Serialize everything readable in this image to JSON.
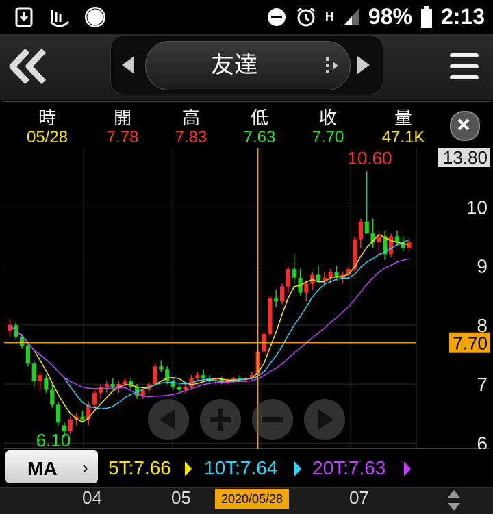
{
  "status": {
    "battery": "98%",
    "time": "2:13",
    "network": "H"
  },
  "header": {
    "stock_name": "友達"
  },
  "quote": {
    "labels": [
      "時",
      "開",
      "高",
      "低",
      "收",
      "量"
    ],
    "values": [
      "05/28",
      "7.78",
      "7.83",
      "7.63",
      "7.70",
      "47.1K"
    ],
    "colors": [
      "#ffe600",
      "#ff3030",
      "#ff3030",
      "#28e028",
      "#28e028",
      "#ffe600"
    ]
  },
  "chart_data": {
    "type": "candlestick",
    "high_marker": "10.60",
    "low_marker": "6.10",
    "price_ticks": [
      "13.80",
      "10",
      "9",
      "8",
      "7",
      "6"
    ],
    "cursor_price": "7.70",
    "x_ticks": [
      "04",
      "05",
      "07"
    ],
    "cursor_date": "2020/05/28",
    "ylim": [
      5.9,
      11.0
    ],
    "candles": [
      [
        7.9,
        8.1,
        7.8,
        8.0
      ],
      [
        8.0,
        8.05,
        7.75,
        7.8
      ],
      [
        7.8,
        7.85,
        7.6,
        7.65
      ],
      [
        7.65,
        7.7,
        7.3,
        7.35
      ],
      [
        7.35,
        7.4,
        6.95,
        7.05
      ],
      [
        7.05,
        7.2,
        6.9,
        7.15
      ],
      [
        7.1,
        7.15,
        6.85,
        6.9
      ],
      [
        6.9,
        7.0,
        6.6,
        6.65
      ],
      [
        6.65,
        6.7,
        6.3,
        6.35
      ],
      [
        6.3,
        6.35,
        6.1,
        6.2
      ],
      [
        6.2,
        6.45,
        6.15,
        6.4
      ],
      [
        6.4,
        6.5,
        6.3,
        6.45
      ],
      [
        6.45,
        6.55,
        6.35,
        6.4
      ],
      [
        6.4,
        6.7,
        6.3,
        6.65
      ],
      [
        6.65,
        6.9,
        6.6,
        6.85
      ],
      [
        6.85,
        7.0,
        6.75,
        6.95
      ],
      [
        6.95,
        7.05,
        6.85,
        7.0
      ],
      [
        7.0,
        7.1,
        6.9,
        6.95
      ],
      [
        6.95,
        7.05,
        6.85,
        7.0
      ],
      [
        7.0,
        7.1,
        6.95,
        7.05
      ],
      [
        7.05,
        7.1,
        6.9,
        6.95
      ],
      [
        6.95,
        7.0,
        6.75,
        6.8
      ],
      [
        6.8,
        6.95,
        6.75,
        6.9
      ],
      [
        6.9,
        7.05,
        6.85,
        7.0
      ],
      [
        7.0,
        7.35,
        6.95,
        7.3
      ],
      [
        7.3,
        7.4,
        7.2,
        7.25
      ],
      [
        7.25,
        7.3,
        7.0,
        7.05
      ],
      [
        7.05,
        7.1,
        6.9,
        6.95
      ],
      [
        6.95,
        7.0,
        6.85,
        6.9
      ],
      [
        6.9,
        7.0,
        6.85,
        6.95
      ],
      [
        6.95,
        7.15,
        6.9,
        7.1
      ],
      [
        7.1,
        7.2,
        7.05,
        7.15
      ],
      [
        7.15,
        7.25,
        7.05,
        7.1
      ],
      [
        7.1,
        7.15,
        7.0,
        7.05
      ],
      [
        7.05,
        7.1,
        7.0,
        7.08
      ],
      [
        7.08,
        7.12,
        7.0,
        7.04
      ],
      [
        7.04,
        7.1,
        7.0,
        7.07
      ],
      [
        7.07,
        7.12,
        7.02,
        7.1
      ],
      [
        7.1,
        7.15,
        7.05,
        7.08
      ],
      [
        7.08,
        7.12,
        7.03,
        7.1
      ],
      [
        7.1,
        7.2,
        7.05,
        7.15
      ],
      [
        7.15,
        7.6,
        7.1,
        7.55
      ],
      [
        7.55,
        7.9,
        7.5,
        7.85
      ],
      [
        7.85,
        8.5,
        7.8,
        8.45
      ],
      [
        8.45,
        8.6,
        8.3,
        8.4
      ],
      [
        8.4,
        8.7,
        8.35,
        8.65
      ],
      [
        8.65,
        9.0,
        8.55,
        8.95
      ],
      [
        8.95,
        9.2,
        8.7,
        8.8
      ],
      [
        8.8,
        8.95,
        8.5,
        8.55
      ],
      [
        8.55,
        8.75,
        8.4,
        8.7
      ],
      [
        8.7,
        8.9,
        8.6,
        8.85
      ],
      [
        8.85,
        9.0,
        8.7,
        8.75
      ],
      [
        8.75,
        8.9,
        8.65,
        8.8
      ],
      [
        8.8,
        8.95,
        8.7,
        8.9
      ],
      [
        8.9,
        9.0,
        8.75,
        8.8
      ],
      [
        8.8,
        8.9,
        8.7,
        8.85
      ],
      [
        8.85,
        9.0,
        8.8,
        8.95
      ],
      [
        8.95,
        9.5,
        8.9,
        9.45
      ],
      [
        9.45,
        9.8,
        9.3,
        9.75
      ],
      [
        9.75,
        10.6,
        9.6,
        9.55
      ],
      [
        9.55,
        9.8,
        9.3,
        9.4
      ],
      [
        9.4,
        9.6,
        9.2,
        9.5
      ],
      [
        9.5,
        9.6,
        9.1,
        9.2
      ],
      [
        9.2,
        9.55,
        9.15,
        9.5
      ],
      [
        9.5,
        9.6,
        9.35,
        9.4
      ],
      [
        9.4,
        9.5,
        9.25,
        9.3
      ],
      [
        9.3,
        9.45,
        9.25,
        9.4
      ]
    ]
  },
  "ma": {
    "button_label": "MA",
    "ma5": "5T:7.66",
    "ma10": "10T:7.64",
    "ma20": "20T:7.63",
    "colors": {
      "ma5": "#ffe600",
      "ma10": "#2ad4ff",
      "ma20": "#c040ff"
    }
  }
}
